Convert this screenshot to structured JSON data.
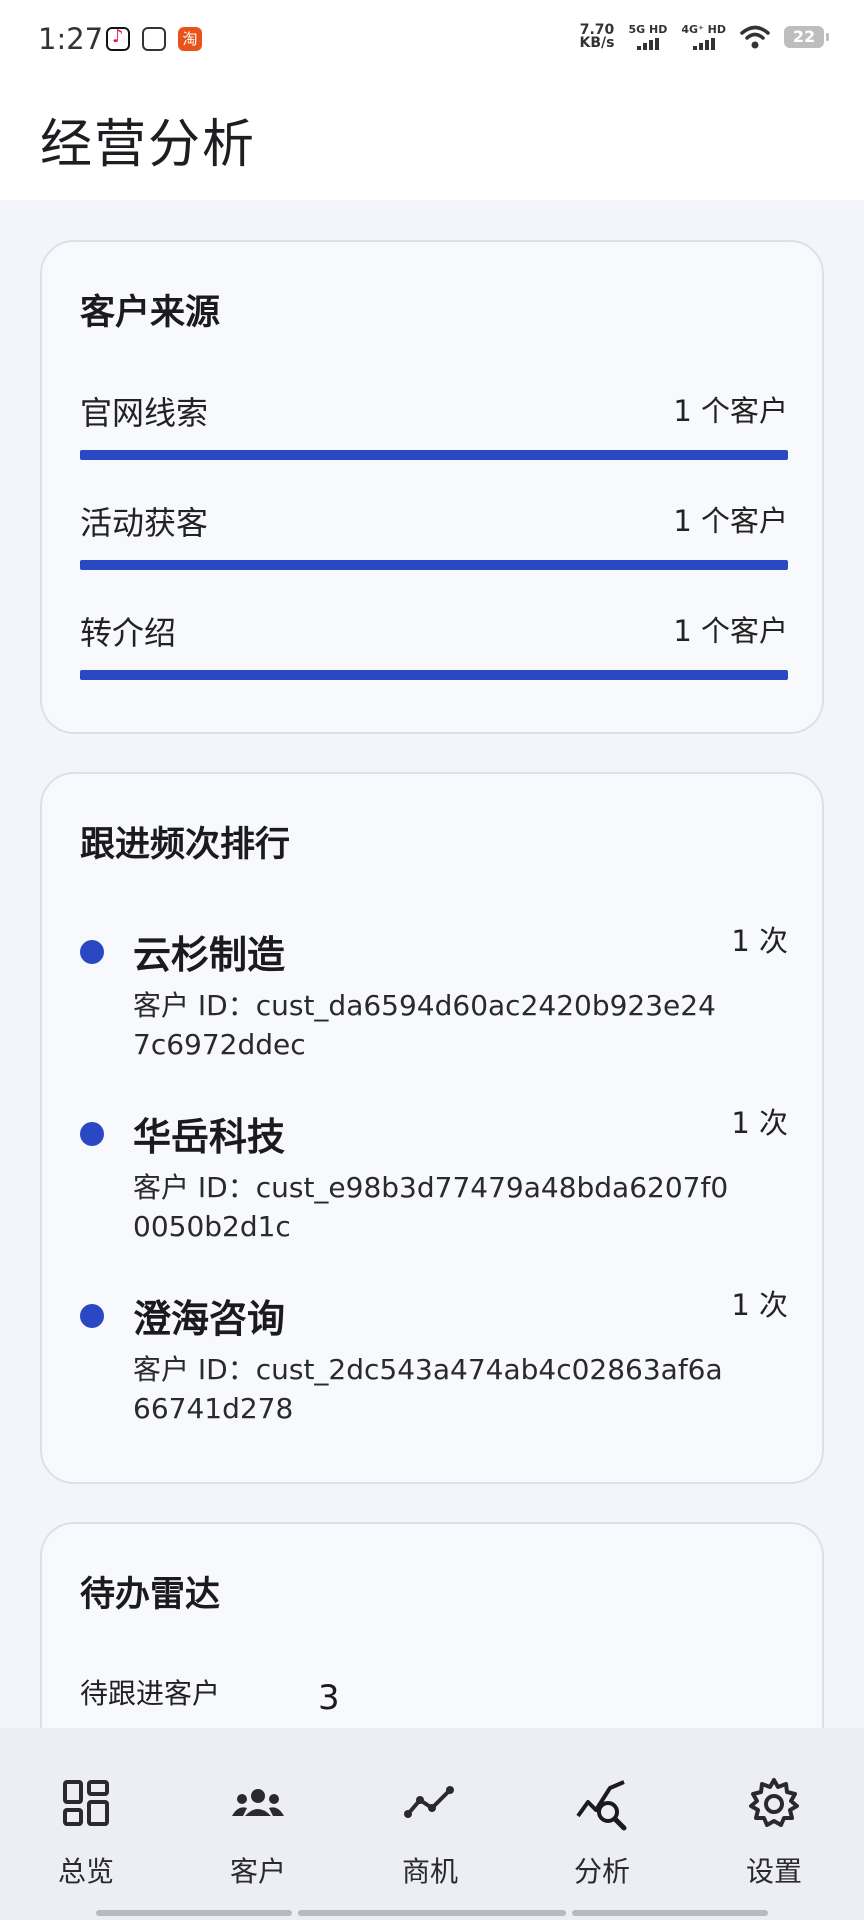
{
  "status_bar": {
    "time": "1:27",
    "speed_value": "7.70",
    "speed_unit": "KB/s",
    "sim1": "5G HD",
    "sim2": "4G⁺ HD",
    "battery": "22"
  },
  "header": {
    "title": "经营分析"
  },
  "customer_source": {
    "title": "客户来源",
    "items": [
      {
        "label": "官网线索",
        "count": "1 个客户",
        "fraction": 1.0
      },
      {
        "label": "活动获客",
        "count": "1 个客户",
        "fraction": 1.0
      },
      {
        "label": "转介绍",
        "count": "1 个客户",
        "fraction": 1.0
      }
    ]
  },
  "follow_rank": {
    "title": "跟进频次排行",
    "items": [
      {
        "name": "云杉制造",
        "count": "1 次",
        "id_text": "客户 ID：cust_da6594d60ac2420b923e247c6972ddec"
      },
      {
        "name": "华岳科技",
        "count": "1 次",
        "id_text": "客户 ID：cust_e98b3d77479a48bda6207f00050b2d1c"
      },
      {
        "name": "澄海咨询",
        "count": "1 次",
        "id_text": "客户 ID：cust_2dc543a474ab4c02863af6a66741d278"
      }
    ]
  },
  "todo_radar": {
    "title": "待办雷达",
    "pending_label": "待跟进客户",
    "pending_value": "3"
  },
  "bottom_nav": {
    "items": [
      {
        "label": "总览",
        "icon": "dashboard-icon"
      },
      {
        "label": "客户",
        "icon": "people-icon"
      },
      {
        "label": "商机",
        "icon": "trend-icon"
      },
      {
        "label": "分析",
        "icon": "analytics-search-icon"
      },
      {
        "label": "设置",
        "icon": "gear-icon"
      }
    ],
    "active_index": 3
  },
  "colors": {
    "accent": "#2b48c4",
    "background": "#f3f5fa",
    "card": "#f8f9fc"
  }
}
